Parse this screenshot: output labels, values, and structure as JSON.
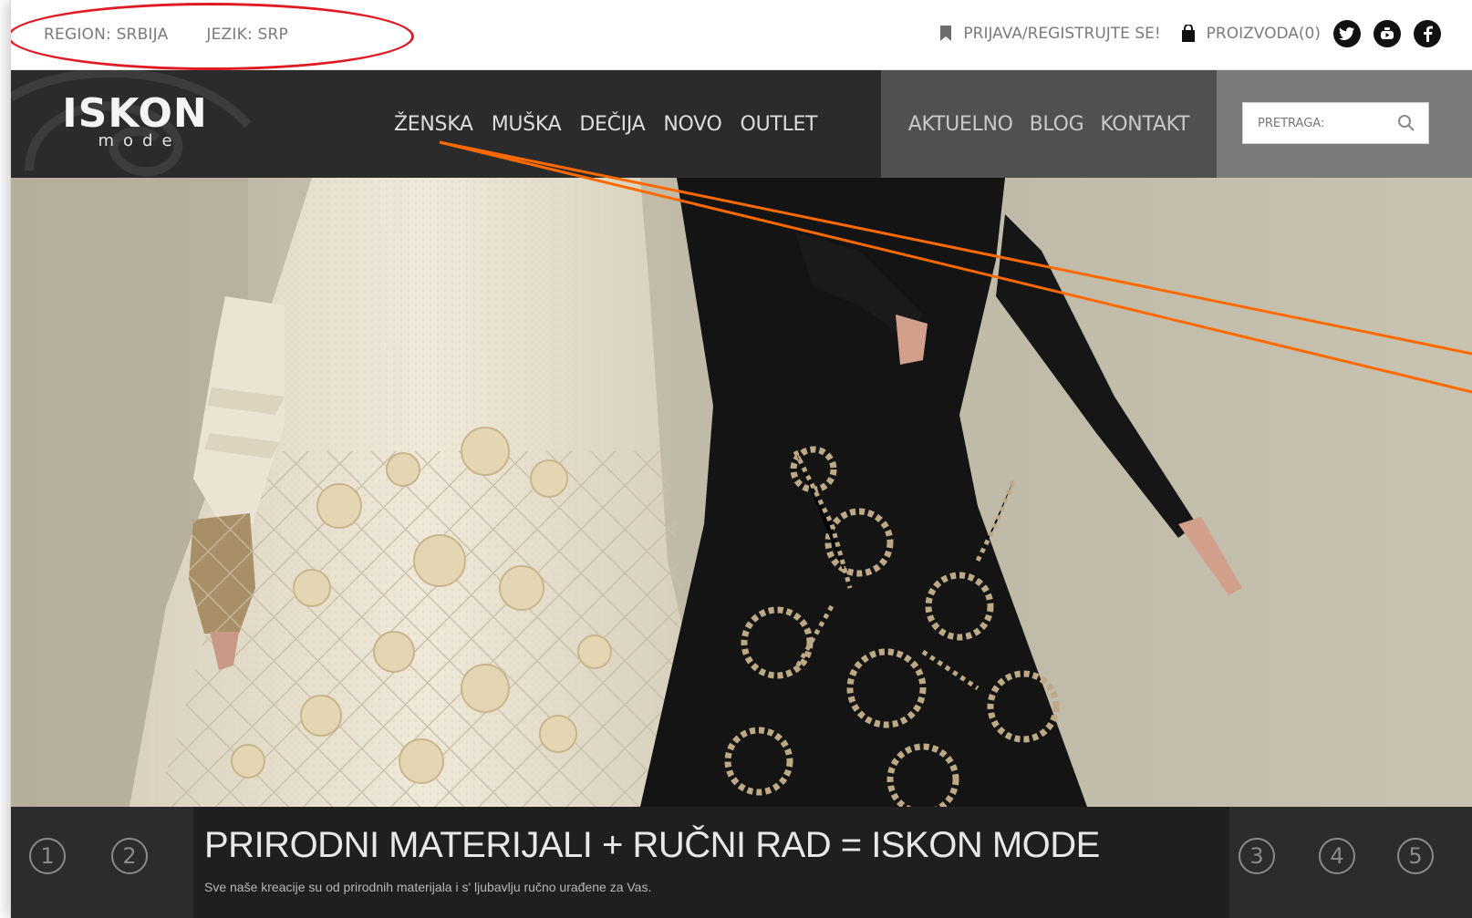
{
  "topbar": {
    "region_label": "REGION: SRBIJA",
    "language_label": "JEZIK: SRP",
    "login_label": "PRIJAVA/REGISTRUJTE SE!",
    "cart_label": "PROIZVODA(0)",
    "social": [
      "twitter-icon",
      "youtube-icon",
      "facebook-icon"
    ]
  },
  "navbar": {
    "logo_word": "ISKON",
    "logo_sub": "mode",
    "main_items": [
      "ŽENSKA",
      "MUŠKA",
      "DEČIJA",
      "NOVO",
      "OUTLET"
    ],
    "secondary_items": [
      "AKTUELNO",
      "BLOG",
      "KONTAKT"
    ],
    "search_placeholder": "PRETRAGA:"
  },
  "slider": {
    "numbers": [
      "1",
      "2",
      "3",
      "4",
      "5"
    ],
    "headline": "PRIRODNI MATERIJALI + RUČNI RAD = ISKON MODE",
    "subline": "Sve naše kreacije su od prirodnih materijala i s' ljubavlju ručno urađene za Vas."
  },
  "colors": {
    "annotation_red": "#e01a22",
    "annotation_orange": "#ff6a00",
    "nav_dark": "#2b2b2b",
    "nav_mid": "#505050",
    "nav_search": "#7a7a7a"
  }
}
